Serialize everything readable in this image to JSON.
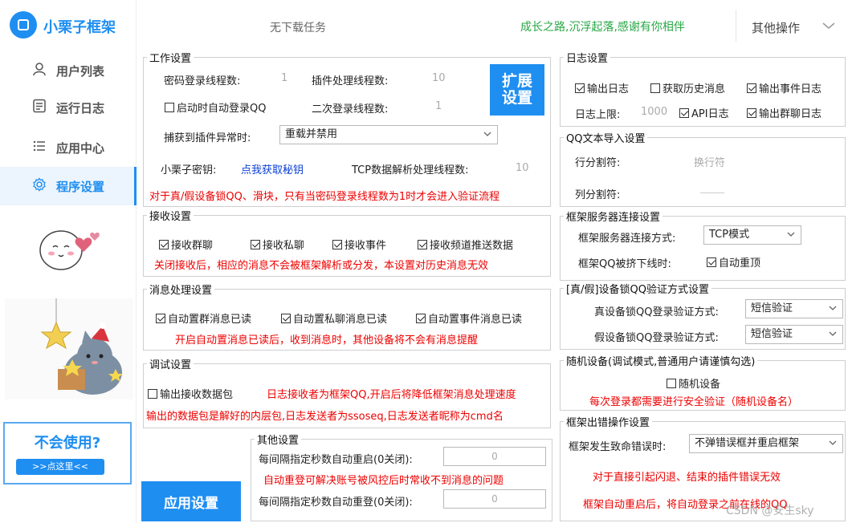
{
  "app": {
    "title": "小栗子框架"
  },
  "sidebar": {
    "items": [
      {
        "label": "用户列表",
        "icon": "user-icon"
      },
      {
        "label": "运行日志",
        "icon": "log-icon"
      },
      {
        "label": "应用中心",
        "icon": "list-icon"
      },
      {
        "label": "程序设置",
        "icon": "gear-icon",
        "active": true
      }
    ],
    "help": {
      "title": "不会使用?",
      "link": ">>点这里<<"
    }
  },
  "header": {
    "status": "无下载任务",
    "motto": "成长之路,沉浮起落,感谢有你相伴",
    "more": "其他操作"
  },
  "work": {
    "legend": "工作设置",
    "pwd_threads_label": "密码登录线程数:",
    "pwd_threads_value": "1",
    "plugin_threads_label": "插件处理线程数:",
    "plugin_threads_value": "10",
    "expand_button": "扩展设置",
    "auto_login_label": "启动时自动登录QQ",
    "auto_login_checked": false,
    "second_login_label": "二次登录线程数:",
    "second_login_value": "1",
    "exception_label": "捕获到插件异常时:",
    "exception_value": "重载并禁用",
    "key_label": "小栗子密钥:",
    "key_link": "点我获取秘钥",
    "tcp_label": "TCP数据解析处理线程数:",
    "tcp_value": "10",
    "note": "对于真/假设备锁QQ、滑块，只有当密码登录线程数为1时才会进入验证流程"
  },
  "receive": {
    "legend": "接收设置",
    "options": [
      {
        "label": "接收群聊",
        "checked": true
      },
      {
        "label": "接收私聊",
        "checked": true
      },
      {
        "label": "接收事件",
        "checked": true
      },
      {
        "label": "接收频道推送数据",
        "checked": true
      }
    ],
    "note": "关闭接收后，相应的消息不会被框架解析或分发，本设置对历史消息无效"
  },
  "message": {
    "legend": "消息处理设置",
    "options": [
      {
        "label": "自动置群消息已读",
        "checked": true
      },
      {
        "label": "自动置私聊消息已读",
        "checked": true
      },
      {
        "label": "自动置事件消息已读",
        "checked": true
      }
    ],
    "note": "开启自动置消息已读后，收到消息时，其他设备将不会有消息提醒"
  },
  "debug": {
    "legend": "调试设置",
    "option": "输出接收数据包",
    "checked": false,
    "note1": "日志接收者为框架QQ,开启后将降低框架消息处理速度",
    "note2": "输出的数据包是解好的内层包,日志发送者为ssoseq,日志发送者昵称为cmd名"
  },
  "apply_button": "应用设置",
  "other": {
    "legend": "其他设置",
    "restart_label": "每间隔指定秒数自动重启(0关闭):",
    "restart_value": "0",
    "note": "自动重登可解决账号被风控后时常收不到消息的问题",
    "relogin_label": "每间隔指定秒数自动重登(0关闭):",
    "relogin_value": "0"
  },
  "log": {
    "legend": "日志设置",
    "output_log": "输出日志",
    "output_log_checked": true,
    "history": "获取历史消息",
    "history_checked": false,
    "event_log": "输出事件日志",
    "event_log_checked": true,
    "limit_label": "日志上限:",
    "limit_value": "1000",
    "api_log": "API日志",
    "api_log_checked": true,
    "group_log": "输出群聊日志",
    "group_log_checked": true
  },
  "qqtext": {
    "legend": "QQ文本导入设置",
    "row_label": "行分割符:",
    "row_value": "换行符",
    "col_label": "列分割符:"
  },
  "server": {
    "legend": "框架服务器连接设置",
    "mode_label": "框架服务器连接方式:",
    "mode_value": "TCP模式",
    "kicked_label": "框架QQ被挤下线时:",
    "auto_relogin": "自动重顶",
    "auto_relogin_checked": true
  },
  "devicelock": {
    "legend": "[真/假]设备锁QQ验证方式设置",
    "real_label": "真设备锁QQ登录验证方式:",
    "real_value": "短信验证",
    "fake_label": "假设备锁QQ登录验证方式:",
    "fake_value": "短信验证"
  },
  "random": {
    "legend": "随机设备(调试模式,普通用户请谨慎勾选)",
    "option": "随机设备",
    "checked": false,
    "note": "每次登录都需要进行安全验证（随机设备名）"
  },
  "error": {
    "legend": "框架出错操作设置",
    "fatal_label": "框架发生致命错误时:",
    "fatal_value": "不弹错误框并重启框架",
    "note1": "对于直接引起闪退、结束的插件错误无效",
    "note2": "框架自动重启后，将自动登录之前在线的QQ"
  },
  "watermark": "CSDN @安生sky",
  "colors": {
    "accent": "#1f8ef1",
    "warn": "#ee0000",
    "motto": "#28a745"
  }
}
